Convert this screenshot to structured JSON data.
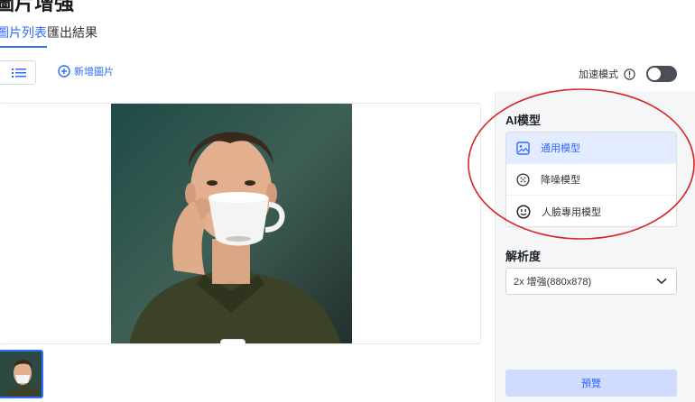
{
  "page": {
    "title": "圖片增強"
  },
  "tabs": [
    {
      "label": "圖片列表",
      "active": true
    },
    {
      "label": "匯出結果",
      "active": false
    }
  ],
  "toolbar": {
    "add_image_label": "新增圖片",
    "speed_mode_label": "加速模式",
    "speed_mode_on": false
  },
  "model_section": {
    "title": "AI模型",
    "models": [
      {
        "label": "通用模型",
        "icon": "image-icon",
        "selected": true
      },
      {
        "label": "降噪模型",
        "icon": "noise-reduction-icon",
        "selected": false
      },
      {
        "label": "人臉專用模型",
        "icon": "face-icon",
        "selected": false
      }
    ]
  },
  "resolution_section": {
    "title": "解析度",
    "selected": "2x 增強(880x878)"
  },
  "preview_button": {
    "label": "預覽"
  },
  "colors": {
    "accent": "#2f6bff",
    "selected_bg": "#e3ebff",
    "annotation": "#d62626"
  }
}
